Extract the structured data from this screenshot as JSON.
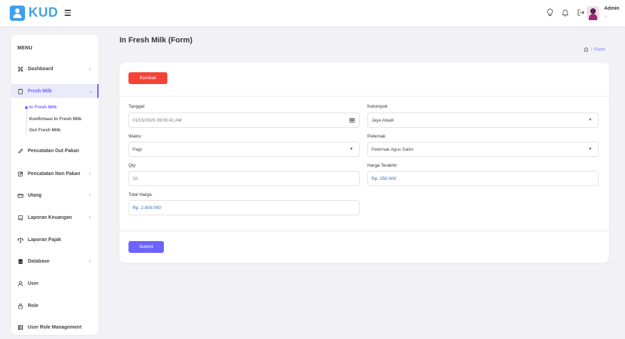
{
  "brand": {
    "name": "KUD"
  },
  "user": {
    "name": "Admin",
    "caret": "⌄"
  },
  "sidebar": {
    "menu_title": "MENU",
    "items": [
      {
        "label": "Dashboard",
        "chevron": "›"
      },
      {
        "label": "Fresh Milk",
        "chevron": "⌄"
      },
      {
        "label": "Pencatatan Out Pakan",
        "chevron": ""
      },
      {
        "label": "Pencatatan Non Pakan",
        "chevron": "›"
      },
      {
        "label": "Utang",
        "chevron": "›"
      },
      {
        "label": "Laporan Keuangan",
        "chevron": "›"
      },
      {
        "label": "Laporan Pajak",
        "chevron": ""
      },
      {
        "label": "Database",
        "chevron": "›"
      },
      {
        "label": "User",
        "chevron": ""
      },
      {
        "label": "Role",
        "chevron": ""
      },
      {
        "label": "User Role Management",
        "chevron": ""
      }
    ],
    "subitems": [
      "In Fresh Milk",
      "Konfirmasi In Fresh Milk",
      "Out Fresh Milk"
    ]
  },
  "page": {
    "title": "In Fresh Milk (Form)",
    "breadcrumb_sep": "/",
    "breadcrumb_current": "Form"
  },
  "form": {
    "back_label": "Kembali",
    "submit_label": "Submit",
    "tanggal": {
      "label": "Tanggal",
      "value": "01/15/2025 09:06:41 AM"
    },
    "kelompok": {
      "label": "Kelompok",
      "value": "Jaya Abadi"
    },
    "waktu": {
      "label": "Waktu",
      "value": "Pagi"
    },
    "peternak": {
      "label": "Peternak",
      "value": "Peternak Agus Salim"
    },
    "qty": {
      "label": "Qty",
      "value": "10"
    },
    "harga_terakhir": {
      "label": "Harga Terakhir",
      "value": "Rp. 250.000"
    },
    "total_harga": {
      "label": "Total Harga",
      "value": "Rp. 2.500.000"
    }
  },
  "colors": {
    "accent": "#6c63ff",
    "danger": "#f44336",
    "brand": "#3fa0ec"
  }
}
